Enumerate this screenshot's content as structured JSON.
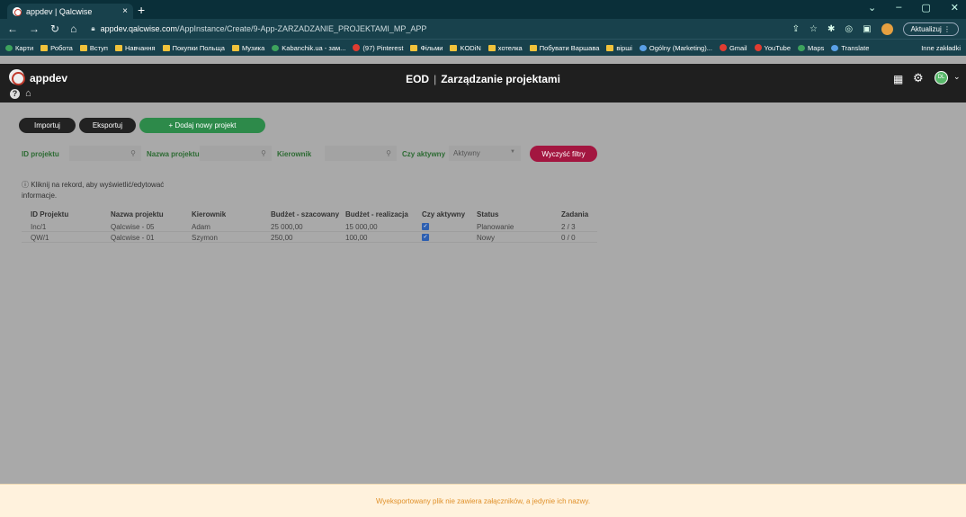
{
  "browser": {
    "tab_title": "appdev | Qalcwise",
    "tab_close": "×",
    "new_tab": "+",
    "url_host": "appdev.qalcwise.com",
    "url_path": "/AppInstance/Create/9-App-ZARZADZANIE_PROJEKTAMI_MP_APP",
    "update_label": "Aktualizuj",
    "bookmarks": [
      "Карти",
      "Робота",
      "Вступ",
      "Навчання",
      "Покупки Польща",
      "Музика",
      "Kabanchik.ua - зам...",
      "(97) Pinterest",
      "Фільми",
      "KODiN",
      "хотелка",
      "Побувати Варшава",
      "вірші",
      "Ogólny (Marketing)...",
      "Gmail",
      "YouTube",
      "Maps",
      "Translate"
    ],
    "bookmarks_right": "Inne zakładki"
  },
  "app": {
    "name": "appdev",
    "title_left": "EOD",
    "title_sep": "|",
    "title_right": "Zarządzanie projektami",
    "avatar_initials": "DL"
  },
  "toolbar": {
    "import_label": "Importuj",
    "export_label": "Eksportuj",
    "add_label": "Dodaj nowy projekt",
    "add_prefix": "+"
  },
  "filters": {
    "id_label": "ID projektu",
    "name_label": "Nazwa projektu",
    "manager_label": "Kierownik",
    "active_label": "Czy aktywny",
    "active_value": "Aktywny",
    "clear_label": "Wyczyść filtry"
  },
  "info": "ⓘ Kliknij na rekord, aby wyświetlić/edytować informacje.",
  "table": {
    "headers": [
      "ID Projektu",
      "Nazwa projektu",
      "Kierownik",
      "Budżet - szacowany",
      "Budżet - realizacja",
      "Czy aktywny",
      "Status",
      "Zadania"
    ],
    "rows": [
      [
        "Inc/1",
        "Qalcwise - 05",
        "Adam",
        "25 000,00",
        "15 000,00",
        "checked",
        "Planowanie",
        "2 / 3"
      ],
      [
        "QW/1",
        "Qalcwise - 01",
        "Szymon",
        "250,00",
        "100,00",
        "checked",
        "Nowy",
        "0 / 0"
      ]
    ]
  },
  "footer": "Wyeksportowany plik nie zawiera załączników, a jedynie ich nazwy.",
  "colors": {
    "accent_green": "#2d8a4a",
    "accent_red": "#a31640",
    "header_dark": "#1f1f1f",
    "footer_bg": "#fff2dd",
    "footer_text": "#e0912b"
  }
}
